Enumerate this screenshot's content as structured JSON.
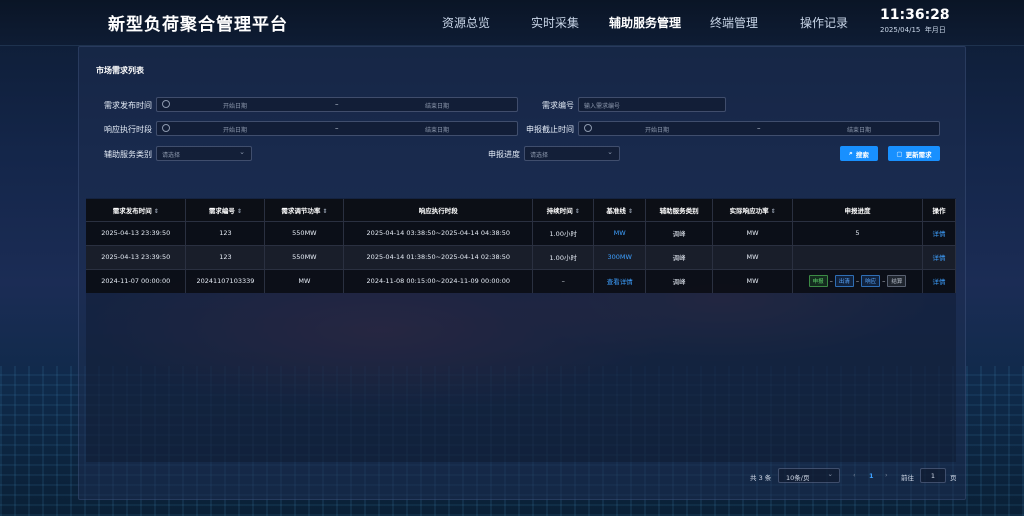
{
  "app": {
    "title": "新型负荷聚合管理平台"
  },
  "nav": [
    "资源总览",
    "实时采集",
    "辅助服务管理",
    "终端管理",
    "操作记录"
  ],
  "clock": {
    "time": "11:36:28",
    "date": "2025/04/15",
    "weekday": "年月日"
  },
  "section_title": "市场需求列表",
  "filters": {
    "release_time": {
      "label": "需求发布时间",
      "start": "开始日期",
      "end": "结束日期",
      "sep": "–"
    },
    "req_no": {
      "label": "需求编号",
      "placeholder": "输入需求编号"
    },
    "exec_period": {
      "label": "响应执行时段",
      "start": "开始日期",
      "end": "结束日期",
      "sep": "–"
    },
    "deadline": {
      "label": "申报截止时间",
      "start": "开始日期",
      "end": "结束日期",
      "sep": "–"
    },
    "service_type": {
      "label": "辅助服务类别",
      "placeholder": "请选择"
    },
    "progress": {
      "label": "申报进度",
      "placeholder": "请选择"
    },
    "search_btn": "搜索",
    "refresh_btn": "更新需求"
  },
  "table": {
    "headers": [
      "需求发布时间",
      "需求编号",
      "需求调节功率",
      "响应执行时段",
      "持续时间",
      "基准线",
      "辅助服务类别",
      "实际响应功率",
      "申报进度",
      "操作"
    ],
    "rows": [
      {
        "time": "2025-04-13 23:39:50",
        "no": "123",
        "power": "550MW",
        "period": "2025-04-14 03:38:50~2025-04-14 04:38:50",
        "dur": "1.00小时",
        "base": "MW",
        "type": "调峰",
        "actual": "MW",
        "progress": "5",
        "op": "详情"
      },
      {
        "time": "2025-04-13 23:39:50",
        "no": "123",
        "power": "550MW",
        "period": "2025-04-14 01:38:50~2025-04-14 02:38:50",
        "dur": "1.00小时",
        "base": "300MW",
        "type": "调峰",
        "actual": "MW",
        "progress": "",
        "op": "详情"
      },
      {
        "time": "2024-11-07 00:00:00",
        "no": "20241107103339",
        "power": "MW",
        "period": "2024-11-08 00:15:00~2024-11-09 00:00:00",
        "dur": "–",
        "base": "查看详情",
        "type": "调峰",
        "actual": "MW",
        "steps": [
          "申报",
          "出清",
          "响应",
          "结算"
        ],
        "op": "详情"
      }
    ]
  },
  "pagination": {
    "total": "共 3 条",
    "page_size": "10条/页",
    "prev": "‹",
    "current": "1",
    "next": "›",
    "goto": "前往",
    "goto_value": "1",
    "page_unit": "页"
  }
}
